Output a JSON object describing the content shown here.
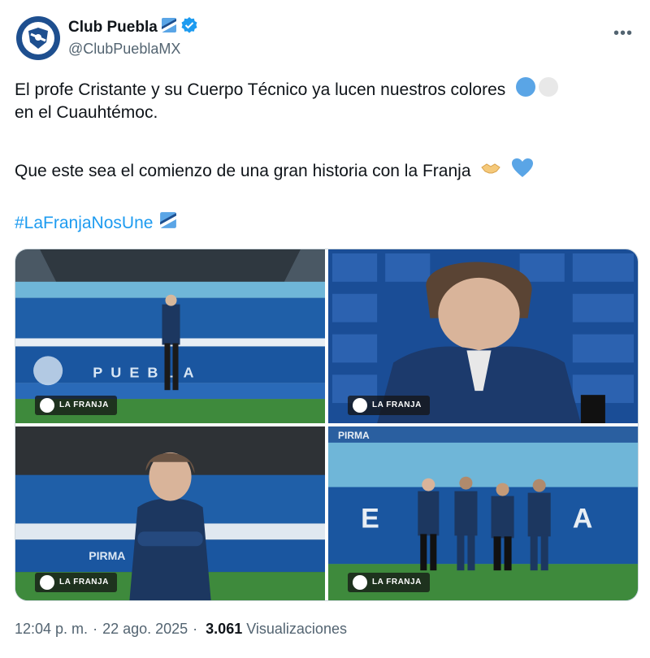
{
  "account": {
    "name": "Club Puebla",
    "handle": "@ClubPueblaMX"
  },
  "tweet": {
    "line1": "El profe Cristante y su Cuerpo Técnico ya lucen nuestros colores",
    "line2": "en el Cuauhtémoc.",
    "line3": "Que este sea el comienzo de una gran historia con la Franja",
    "hashtag": "#LaFranjaNosUne"
  },
  "photos": [
    {
      "id": "stadium-standing",
      "text": "PUEBLA",
      "watermark": "LA FRANJA"
    },
    {
      "id": "press-conference",
      "watermark": "LA FRANJA"
    },
    {
      "id": "arms-crossed",
      "text": "PIRMA",
      "watermark": "LA FRANJA"
    },
    {
      "id": "coaching-staff",
      "text": "PIRMA",
      "watermark": "LA FRANJA"
    }
  ],
  "footer": {
    "time": "12:04 p. m.",
    "date": "22 ago. 2025",
    "views_count": "3.061",
    "views_label": "Visualizaciones"
  },
  "colors": {
    "link": "#1d9bf0",
    "muted": "#536471",
    "brand_blue": "#1e4f8f"
  }
}
